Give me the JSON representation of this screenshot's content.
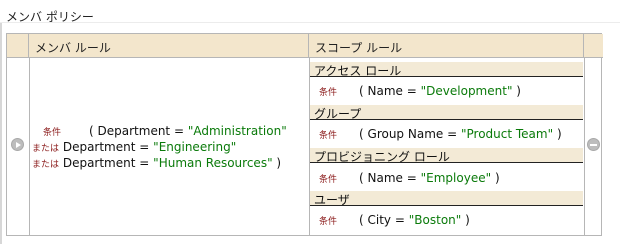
{
  "page": {
    "title": "メンバ ポリシー"
  },
  "table": {
    "headers": {
      "member_rule": "メンバ ルール",
      "scope_rule": "スコープ ルール"
    }
  },
  "member_rule": {
    "condition_keyword": "条件",
    "or_keyword": "または",
    "open_paren": "(",
    "close_paren": ")",
    "clauses": [
      {
        "attribute": "Department",
        "operator": "=",
        "value": "\"Administration\""
      },
      {
        "attribute": "Department",
        "operator": "=",
        "value": "\"Engineering\""
      },
      {
        "attribute": "Department",
        "operator": "=",
        "value": "\"Human Resources\""
      }
    ]
  },
  "scope_rules": [
    {
      "title": "アクセス ロール",
      "keyword": "条件",
      "open_paren": "(",
      "attribute": "Name",
      "operator": "=",
      "value": "\"Development\"",
      "close_paren": ")"
    },
    {
      "title": "グループ",
      "keyword": "条件",
      "open_paren": "(",
      "attribute": "Group Name",
      "operator": "=",
      "value": "\"Product Team\"",
      "close_paren": ")"
    },
    {
      "title": "プロビジョニング ロール",
      "keyword": "条件",
      "open_paren": "(",
      "attribute": "Name",
      "operator": "=",
      "value": "\"Employee\"",
      "close_paren": ")"
    },
    {
      "title": "ユーザ",
      "keyword": "条件",
      "open_paren": "(",
      "attribute": "City",
      "operator": "=",
      "value": "\"Boston\"",
      "close_paren": ")"
    }
  ],
  "icons": {
    "expand": "arrow-right-circle-icon",
    "remove": "minus-circle-icon"
  },
  "colors": {
    "header_bg": "#f3e6cc",
    "keyword": "#8b1a1a",
    "string_value": "#0a7a0a",
    "border": "#b6b6b6"
  }
}
